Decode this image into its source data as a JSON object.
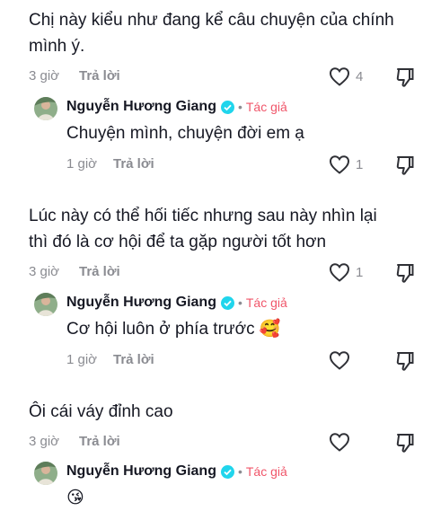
{
  "comments": [
    {
      "text": "Chị này kiểu như đang kể câu chuyện của chính mình ý.",
      "time": "3 giờ",
      "reply_label": "Trả lời",
      "likes": "4",
      "reply": {
        "author": "Nguyễn Hương Giang",
        "separator": "•",
        "author_tag": "Tác giả",
        "text": "Chuyện mình, chuyện đời em ạ",
        "time": "1 giờ",
        "reply_label": "Trả lời",
        "likes": "1"
      }
    },
    {
      "text": "Lúc này có thể hối tiếc nhưng sau này nhìn lại thì đó là cơ hội để ta gặp người tốt hơn",
      "time": "3 giờ",
      "reply_label": "Trả lời",
      "likes": "1",
      "reply": {
        "author": "Nguyễn Hương Giang",
        "separator": "•",
        "author_tag": "Tác giả",
        "text": "Cơ hội luôn ở phía trước 🥰",
        "time": "1 giờ",
        "reply_label": "Trả lời",
        "likes": ""
      }
    },
    {
      "text": "Ôi cái váy đỉnh cao",
      "time": "3 giờ",
      "reply_label": "Trả lời",
      "likes": "",
      "reply": {
        "author": "Nguyễn Hương Giang",
        "separator": "•",
        "author_tag": "Tác giả",
        "text": "😘"
      }
    }
  ],
  "colors": {
    "text": "#161823",
    "muted": "#8a8b91",
    "author_tag": "#f0566a",
    "verified": "#20d5ec"
  },
  "icons": [
    "heart-icon",
    "dislike-icon",
    "verified-badge-icon",
    "avatar"
  ]
}
